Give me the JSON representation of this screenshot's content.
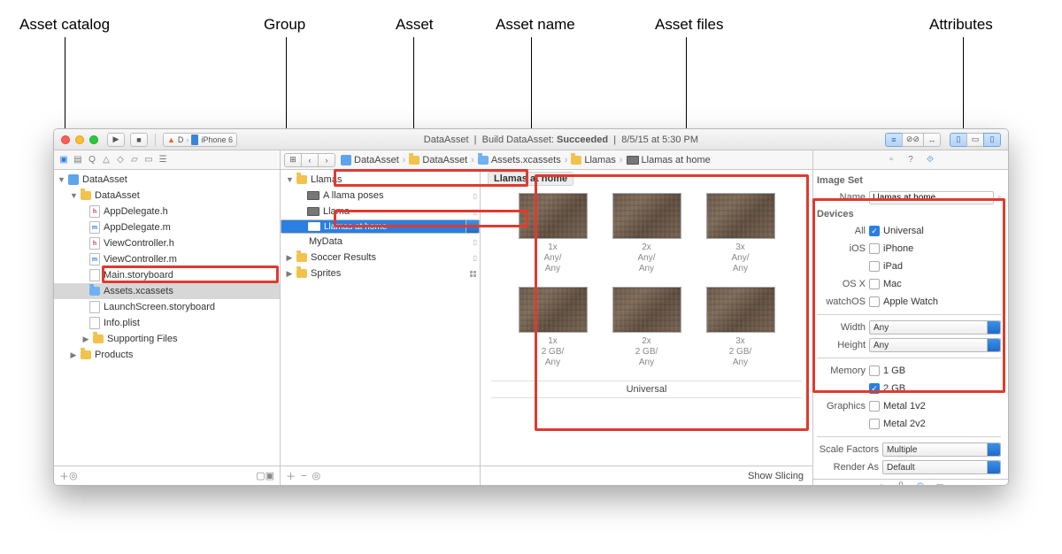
{
  "annotations": {
    "catalog": "Asset catalog",
    "group": "Group",
    "asset": "Asset",
    "asset_name": "Asset name",
    "asset_files": "Asset files",
    "attributes": "Attributes"
  },
  "toolbar": {
    "scheme": "D",
    "destination": "iPhone 6",
    "project": "DataAsset",
    "activity": "Build DataAsset:",
    "status": "Succeeded",
    "timestamp": "8/5/15 at 5:30 PM"
  },
  "breadcrumb": [
    "DataAsset",
    "DataAsset",
    "Assets.xcassets",
    "Llamas",
    "Llamas at home"
  ],
  "project_nav": {
    "root": "DataAsset",
    "group": "DataAsset",
    "files": [
      "AppDelegate.h",
      "AppDelegate.m",
      "ViewController.h",
      "ViewController.m",
      "Main.storyboard",
      "Assets.xcassets",
      "LaunchScreen.storyboard",
      "Info.plist"
    ],
    "supporting": "Supporting Files",
    "products": "Products"
  },
  "outline": {
    "groups": [
      {
        "name": "Llamas",
        "open": true,
        "items": [
          "A llama poses",
          "Llama",
          "Llamas at home"
        ]
      },
      {
        "name": "MyData",
        "open": false,
        "items": []
      },
      {
        "name": "Soccer Results",
        "open": false,
        "items": []
      },
      {
        "name": "Sprites",
        "open": false,
        "items": []
      }
    ],
    "selected": "Llamas at home"
  },
  "canvas": {
    "asset_name": "Llamas at home",
    "rows": [
      {
        "slots": [
          {
            "scale": "1x",
            "desc": "Any/\nAny"
          },
          {
            "scale": "2x",
            "desc": "Any/\nAny"
          },
          {
            "scale": "3x",
            "desc": "Any/\nAny"
          }
        ]
      },
      {
        "slots": [
          {
            "scale": "1x",
            "desc": "2 GB/\nAny"
          },
          {
            "scale": "2x",
            "desc": "2 GB/\nAny"
          },
          {
            "scale": "3x",
            "desc": "2 GB/\nAny"
          }
        ]
      }
    ],
    "footer_label": "Universal",
    "show_slicing": "Show Slicing"
  },
  "inspector": {
    "section_imageset": "Image Set",
    "name_label": "Name",
    "name_value": "Llamas at home",
    "section_devices": "Devices",
    "devices": {
      "all": "All",
      "universal": "Universal",
      "ios": "iOS",
      "iphone": "iPhone",
      "ipad": "iPad",
      "osx": "OS X",
      "mac": "Mac",
      "watchos": "watchOS",
      "watch": "Apple Watch"
    },
    "width_label": "Width",
    "width_value": "Any",
    "height_label": "Height",
    "height_value": "Any",
    "memory_label": "Memory",
    "mem1": "1 GB",
    "mem2": "2 GB",
    "graphics_label": "Graphics",
    "g1": "Metal 1v2",
    "g2": "Metal 2v2",
    "scale_label": "Scale Factors",
    "scale_value": "Multiple",
    "render_label": "Render As",
    "render_value": "Default"
  }
}
